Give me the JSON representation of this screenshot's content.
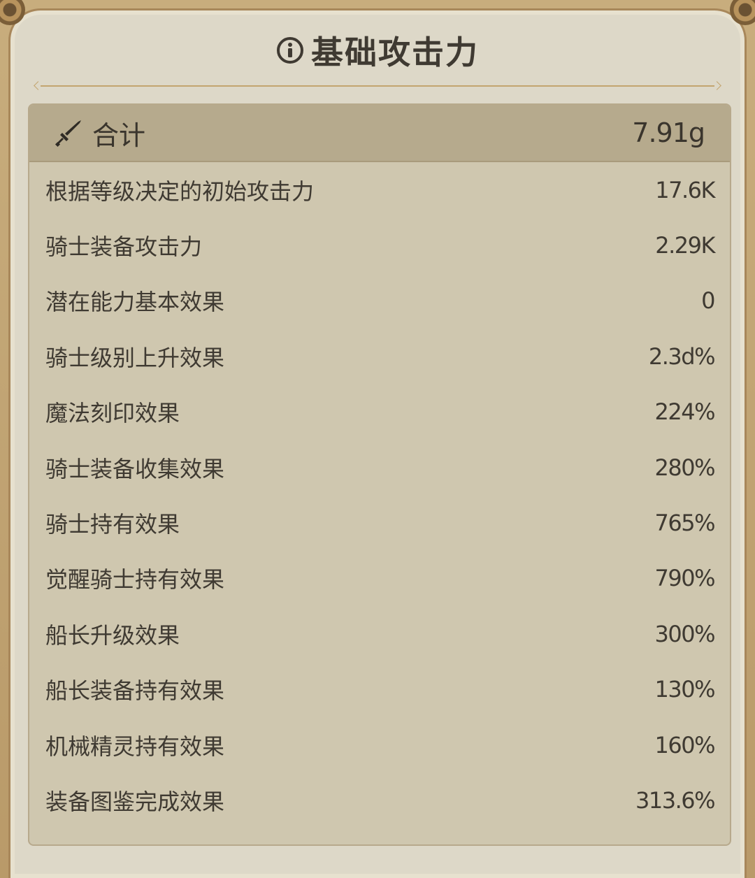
{
  "header": {
    "title": "基础攻击力",
    "title_icon": "info-icon"
  },
  "total": {
    "icon": "sword-icon",
    "label": "合计",
    "value": "7.91g"
  },
  "rows": [
    {
      "label": "根据等级决定的初始攻击力",
      "value": "17.6K"
    },
    {
      "label": "骑士装备攻击力",
      "value": "2.29K"
    },
    {
      "label": "潜在能力基本效果",
      "value": "0"
    },
    {
      "label": "骑士级别上升效果",
      "value": "2.3d%"
    },
    {
      "label": "魔法刻印效果",
      "value": "224%"
    },
    {
      "label": "骑士装备收集效果",
      "value": "280%"
    },
    {
      "label": "骑士持有效果",
      "value": "765%"
    },
    {
      "label": "觉醒骑士持有效果",
      "value": "790%"
    },
    {
      "label": "船长升级效果",
      "value": "300%"
    },
    {
      "label": "船长装备持有效果",
      "value": "130%"
    },
    {
      "label": "机械精灵持有效果",
      "value": "160%"
    },
    {
      "label": "装备图鉴完成效果",
      "value": "313.6%"
    }
  ],
  "colors": {
    "frame": "#c8ad7d",
    "background": "#ddd8c8",
    "panel": "#cfc7af",
    "total_bar": "#b6aa8d",
    "text": "#3f3a32"
  }
}
